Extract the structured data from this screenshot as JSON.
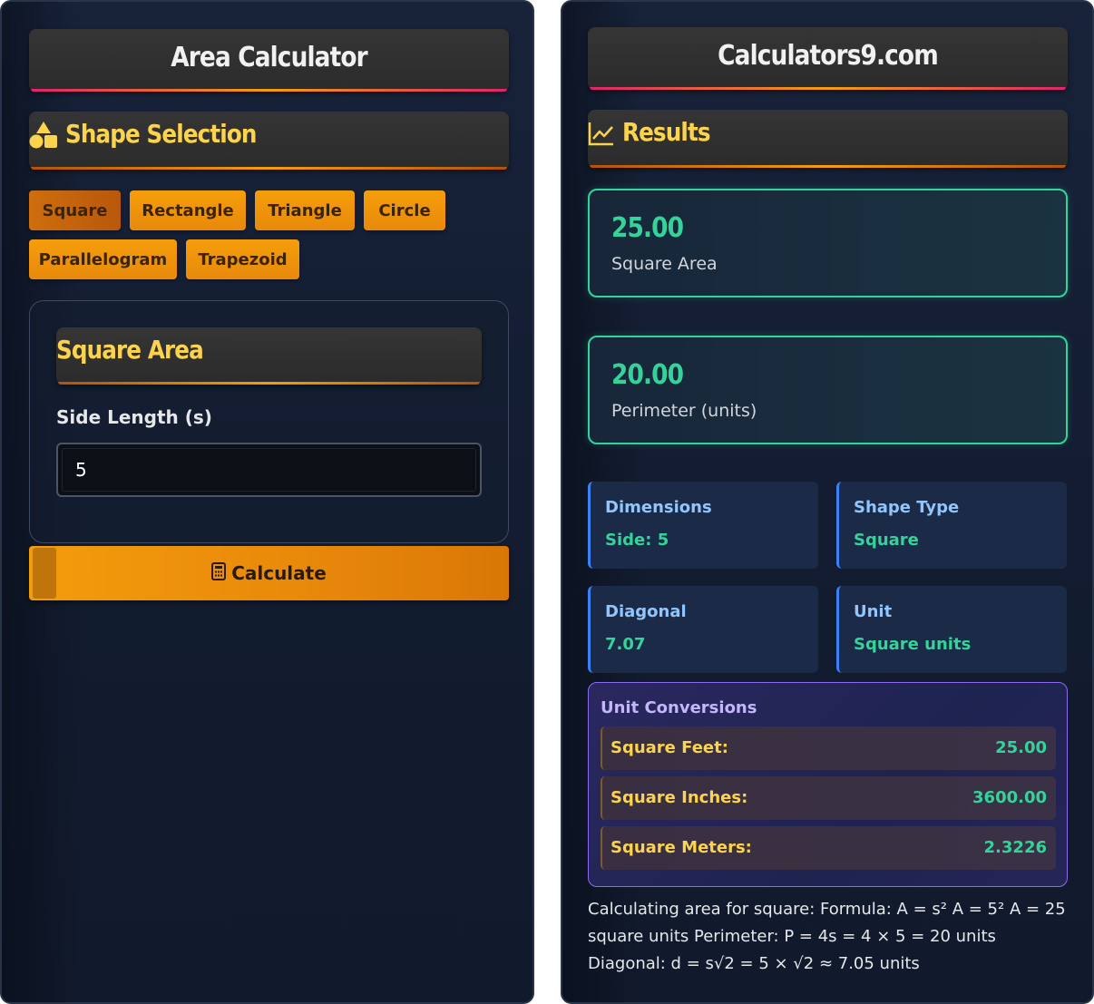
{
  "left": {
    "title": "Area Calculator",
    "shape_section_title": "Shape Selection",
    "shapes": [
      "Square",
      "Rectangle",
      "Triangle",
      "Circle",
      "Parallelogram",
      "Trapezoid"
    ],
    "active_shape": "Square",
    "form": {
      "title": "Square Area",
      "field_label": "Side Length (s)",
      "field_value": "5"
    },
    "calculate_label": "Calculate"
  },
  "right": {
    "title": "Calculators9.com",
    "results_title": "Results",
    "area": {
      "value": "25.00",
      "label": "Square Area"
    },
    "perimeter": {
      "value": "20.00",
      "label": "Perimeter (units)"
    },
    "info": [
      {
        "title": "Dimensions",
        "value": "Side: 5"
      },
      {
        "title": "Shape Type",
        "value": "Square"
      },
      {
        "title": "Diagonal",
        "value": "7.07"
      },
      {
        "title": "Unit",
        "value": "Square units"
      }
    ],
    "conversions_title": "Unit Conversions",
    "conversions": [
      {
        "name": "Square Feet:",
        "value": "25.00"
      },
      {
        "name": "Square Inches:",
        "value": "3600.00"
      },
      {
        "name": "Square Meters:",
        "value": "2.3226"
      }
    ],
    "explanation": "Calculating area for square: Formula: A = s² A = 5² A = 25 square units Perimeter: P = 4s = 4 × 5 = 20 units Diagonal: d = s√2 = 5 × √2 ≈ 7.05 units"
  },
  "colors": {
    "accent": "#f59e0b",
    "heading_gold": "#fcd34d",
    "result_green": "#34d399",
    "info_blue": "#93c5fd",
    "conversion_purple": "#8b6cf0"
  }
}
